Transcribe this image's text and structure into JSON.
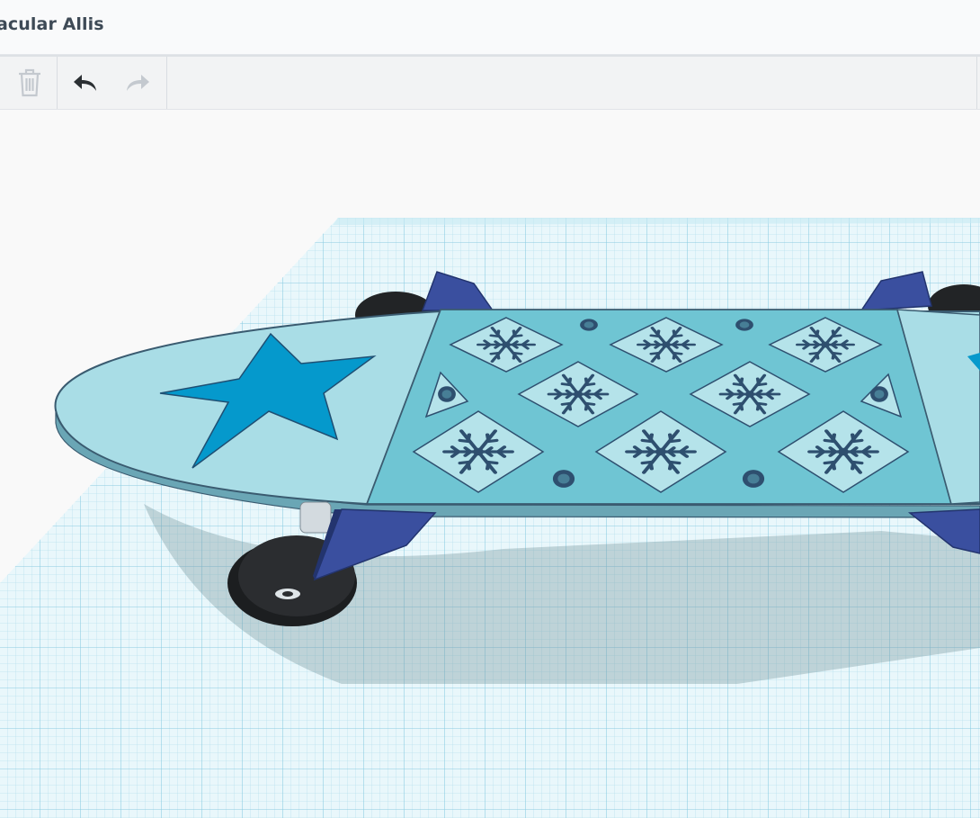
{
  "header": {
    "title": "acular Allis"
  },
  "toolbar": {
    "buttons": [
      {
        "name": "delete",
        "icon": "trash-icon",
        "enabled": false
      },
      {
        "name": "undo",
        "icon": "undo-icon",
        "enabled": true
      },
      {
        "name": "redo",
        "icon": "redo-icon",
        "enabled": false
      }
    ]
  },
  "colors": {
    "grid": "#bfe6f2",
    "grid_major": "#8fd0e6",
    "deck": "#a9dde6",
    "center_panel": "#6fc5d3",
    "star": "#0599cc",
    "trucks": "#3a4f9f",
    "wheels": "#222426"
  }
}
